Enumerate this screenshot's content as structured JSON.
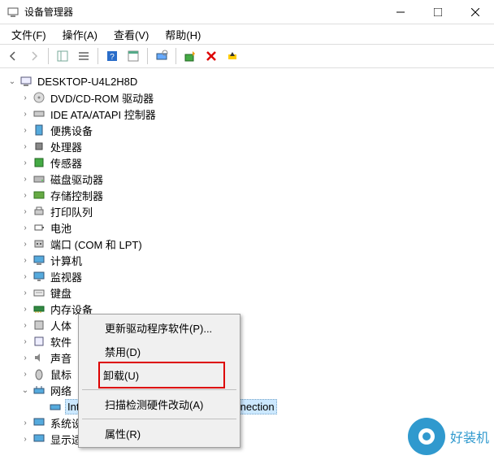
{
  "window": {
    "title": "设备管理器"
  },
  "menu": {
    "file": "文件(F)",
    "action": "操作(A)",
    "view": "查看(V)",
    "help": "帮助(H)"
  },
  "tree": {
    "root": "DESKTOP-U4L2H8D",
    "items": [
      "DVD/CD-ROM 驱动器",
      "IDE ATA/ATAPI 控制器",
      "便携设备",
      "处理器",
      "传感器",
      "磁盘驱动器",
      "存储控制器",
      "打印队列",
      "电池",
      "端口 (COM 和 LPT)",
      "计算机",
      "监视器",
      "键盘",
      "内存设备",
      "人体",
      "软件",
      "声音",
      "鼠标",
      "网络"
    ],
    "network_child": "Intel(R) 82574L Gigabit Network Connection",
    "tail": [
      "系统设备",
      "显示适配器"
    ]
  },
  "context_menu": {
    "update": "更新驱动程序软件(P)...",
    "disable": "禁用(D)",
    "uninstall": "卸载(U)",
    "scan": "扫描检测硬件改动(A)",
    "properties": "属性(R)"
  },
  "watermark": "好装机"
}
